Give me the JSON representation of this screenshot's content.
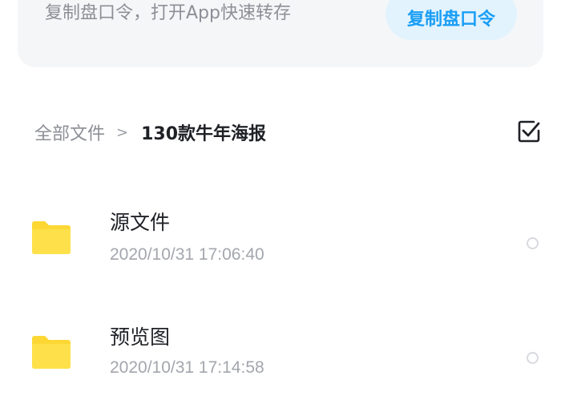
{
  "share": {
    "tip": "复制盘口令，打开App快速转存",
    "button_label": "复制盘口令"
  },
  "breadcrumb": {
    "root": "全部文件",
    "separator": ">",
    "current": "130款牛年海报"
  },
  "icons": {
    "select_all": "checkbox-checked-icon",
    "folder": "folder-icon",
    "row_select": "radio-circle-icon"
  },
  "colors": {
    "accent": "#1a9ef5",
    "folder": "#fdd835"
  },
  "files": [
    {
      "name": "源文件",
      "time": "2020/10/31 17:06:40"
    },
    {
      "name": "预览图",
      "time": "2020/10/31 17:14:58"
    }
  ]
}
